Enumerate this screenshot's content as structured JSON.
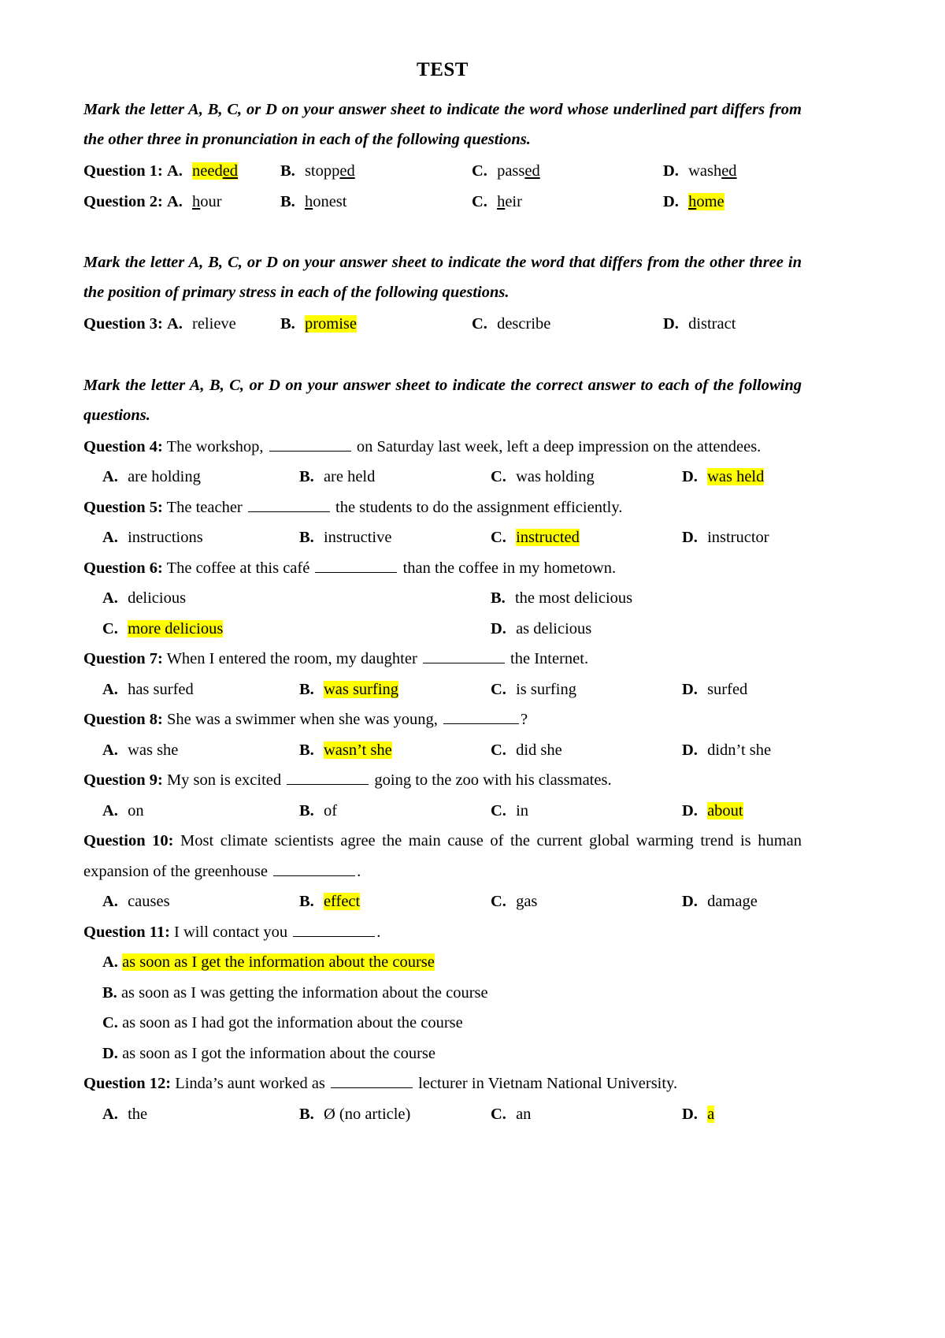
{
  "document": {
    "title": "TEST"
  },
  "sections": [
    {
      "id": "pronunciation",
      "instruction": "Mark the letter A, B, C, or D on your answer sheet to indicate the word whose underlined part differs from the other three in pronunciation in each of the following questions."
    },
    {
      "id": "stress",
      "instruction": "Mark the letter A, B, C, or D on your answer sheet to indicate the word that differs from the other three in the position of primary stress in each of the following questions."
    },
    {
      "id": "grammar",
      "instruction": "Mark the letter A, B, C, or D on your answer sheet to indicate the correct answer to each of the following questions."
    }
  ],
  "questions": {
    "q1": {
      "label": "Question 1:",
      "options": [
        {
          "letter": "A.",
          "pre": "need",
          "under": "ed",
          "post": "",
          "highlight": true
        },
        {
          "letter": "B.",
          "pre": "stopp",
          "under": "ed",
          "post": "",
          "highlight": false
        },
        {
          "letter": "C.",
          "pre": "pass",
          "under": "ed",
          "post": "",
          "highlight": false
        },
        {
          "letter": "D.",
          "pre": "wash",
          "under": "ed",
          "post": "",
          "highlight": false
        }
      ]
    },
    "q2": {
      "label": "Question 2:",
      "options": [
        {
          "letter": "A.",
          "pre": "",
          "under": "h",
          "post": "our",
          "highlight": false
        },
        {
          "letter": "B.",
          "pre": "",
          "under": "h",
          "post": "onest",
          "highlight": false
        },
        {
          "letter": "C.",
          "pre": "",
          "under": "h",
          "post": "eir",
          "highlight": false
        },
        {
          "letter": "D.",
          "pre": "",
          "under": "h",
          "post": "ome",
          "highlight": true
        }
      ]
    },
    "q3": {
      "label": "Question 3:",
      "options": [
        {
          "letter": "A.",
          "text": "relieve",
          "highlight": false
        },
        {
          "letter": "B.",
          "text": "promise",
          "highlight": true
        },
        {
          "letter": "C.",
          "text": "describe",
          "highlight": false
        },
        {
          "letter": "D.",
          "text": "distract",
          "highlight": false
        }
      ]
    },
    "q4": {
      "label": "Question 4:",
      "stem_part1": "The workshop,",
      "stem_part2": "on Saturday last week, left a deep impression on the attendees.",
      "options": [
        {
          "letter": "A.",
          "text": "are holding",
          "highlight": false
        },
        {
          "letter": "B.",
          "text": "are held",
          "highlight": false
        },
        {
          "letter": "C.",
          "text": "was holding",
          "highlight": false
        },
        {
          "letter": "D.",
          "text": "was held",
          "highlight": true
        }
      ]
    },
    "q5": {
      "label": "Question 5:",
      "stem_part1": "The teacher",
      "stem_part2": "the students to do the assignment efficiently.",
      "options": [
        {
          "letter": "A.",
          "text": "instructions",
          "highlight": false
        },
        {
          "letter": "B.",
          "text": "instructive",
          "highlight": false
        },
        {
          "letter": "C.",
          "text": "instructed",
          "highlight": true
        },
        {
          "letter": "D.",
          "text": "instructor",
          "highlight": false
        }
      ]
    },
    "q6": {
      "label": "Question 6:",
      "stem_part1": "The coffee at this café",
      "stem_part2": "than the coffee in my hometown.",
      "options": [
        {
          "letter": "A.",
          "text": "delicious",
          "highlight": false
        },
        {
          "letter": "B.",
          "text": "the most delicious",
          "highlight": false
        },
        {
          "letter": "C.",
          "text": "more delicious",
          "highlight": true
        },
        {
          "letter": "D.",
          "text": "as delicious",
          "highlight": false
        }
      ]
    },
    "q7": {
      "label": "Question 7:",
      "stem_part1": "When I entered the room, my daughter",
      "stem_part2": "the Internet.",
      "options": [
        {
          "letter": "A.",
          "text": "has surfed",
          "highlight": false
        },
        {
          "letter": "B.",
          "text": "was surfing",
          "highlight": true
        },
        {
          "letter": "C.",
          "text": "is surfing",
          "highlight": false
        },
        {
          "letter": "D.",
          "text": "surfed",
          "highlight": false
        }
      ]
    },
    "q8": {
      "label": "Question 8:",
      "stem_part1": "She was a swimmer when she was young,",
      "stem_part2": "?",
      "options": [
        {
          "letter": "A.",
          "text": "was she",
          "highlight": false
        },
        {
          "letter": "B.",
          "text": "wasn’t she",
          "highlight": true
        },
        {
          "letter": "C.",
          "text": "did she",
          "highlight": false
        },
        {
          "letter": "D.",
          "text": "didn’t she",
          "highlight": false
        }
      ]
    },
    "q9": {
      "label": "Question 9:",
      "stem_part1": "My son is excited",
      "stem_part2": "going to the zoo with his classmates.",
      "options": [
        {
          "letter": "A.",
          "text": "on",
          "highlight": false
        },
        {
          "letter": "B.",
          "text": "of",
          "highlight": false
        },
        {
          "letter": "C.",
          "text": "in",
          "highlight": false
        },
        {
          "letter": "D.",
          "text": "about",
          "highlight": true
        }
      ]
    },
    "q10": {
      "label": "Question 10:",
      "stem_part1": "Most climate scientists agree the main cause of the current global warming trend is human expansion of the greenhouse",
      "stem_part2": ".",
      "options": [
        {
          "letter": "A.",
          "text": "causes",
          "highlight": false
        },
        {
          "letter": "B.",
          "text": "effect",
          "highlight": true
        },
        {
          "letter": "C.",
          "text": "gas",
          "highlight": false
        },
        {
          "letter": "D.",
          "text": "damage",
          "highlight": false
        }
      ]
    },
    "q11": {
      "label": "Question 11:",
      "stem_part1": "I will contact you",
      "stem_part2": ".",
      "options": [
        {
          "letter": "A.",
          "text": "as soon as I get the information about the course",
          "highlight": true
        },
        {
          "letter": "B.",
          "text": "as soon as I was getting the information about the course",
          "highlight": false
        },
        {
          "letter": "C.",
          "text": "as soon as I had got the information about the course",
          "highlight": false
        },
        {
          "letter": "D.",
          "text": "as soon as I got the information about the course",
          "highlight": false
        }
      ]
    },
    "q12": {
      "label": "Question 12:",
      "stem_part1": "Linda’s aunt worked as",
      "stem_part2": "lecturer in Vietnam National University.",
      "options": [
        {
          "letter": "A.",
          "text": "the",
          "highlight": false
        },
        {
          "letter": "B.",
          "text": "Ø (no article)",
          "highlight": false
        },
        {
          "letter": "C.",
          "text": "an",
          "highlight": false
        },
        {
          "letter": "D.",
          "text": "a",
          "highlight": true
        }
      ]
    }
  },
  "colors": {
    "highlight": "#ffff00",
    "text": "#000000",
    "background": "#ffffff"
  }
}
